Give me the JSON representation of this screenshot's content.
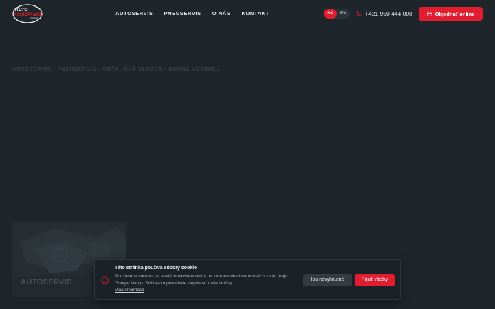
{
  "header": {
    "logo": {
      "line1": "AUTO",
      "line2": "ASSISTANCE",
      "line3": "GROUP"
    },
    "nav": [
      {
        "label": "AUTOSERVIS"
      },
      {
        "label": "PNEUSERVIS"
      },
      {
        "label": "O NÁS"
      },
      {
        "label": "KONTAKT"
      }
    ],
    "languages": [
      {
        "label": "SK",
        "active": true
      },
      {
        "label": "EN",
        "active": false
      }
    ],
    "phone": "+421 950 444 008",
    "order_button": "Objednať online"
  },
  "hero": {
    "tagline": "AUTOSERVIS • PNEUSERVIS • ODŤAHOVÁ SLUŽBA • DOVOZ VOZIDIEL"
  },
  "card": {
    "title": "AUTOSERVIS"
  },
  "cookie": {
    "title": "Táto stránka používa súbory cookie",
    "text": "Používame cookies na analýzu návštevnosti a na zobrazenie obsahu tretích strán (napr. Google Mapy). Súhlasom pomáhate zlepšovať naše služby.",
    "link": "Viac informácií",
    "necessary_button": "Iba nevyhnutné",
    "accept_button": "Prijať všetky"
  },
  "colors": {
    "accent": "#e11d2f",
    "background": "#1f262b"
  }
}
